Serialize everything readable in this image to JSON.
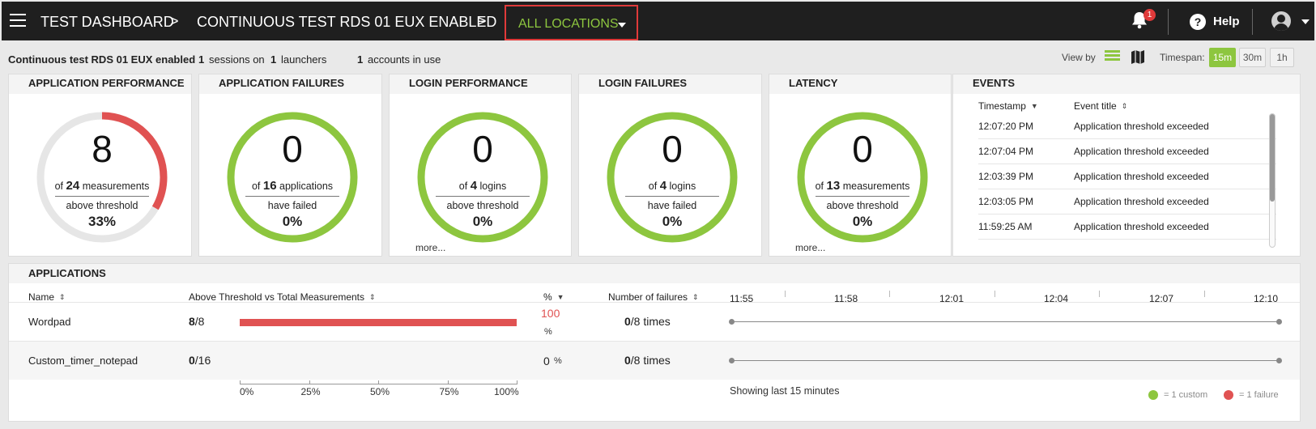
{
  "header": {
    "breadcrumb": [
      "TEST DASHBOARD",
      "CONTINUOUS TEST RDS 01 EUX ENABLED"
    ],
    "separator": ">",
    "location_selector": "ALL LOCATIONS",
    "notification_count": "1",
    "help_icon_glyph": "?",
    "help_label": "Help"
  },
  "info": {
    "test_name": "Continuous test RDS 01 EUX enabled",
    "sessions_count": "1",
    "sessions_label": "sessions on",
    "launchers_count": "1",
    "launchers_label": "launchers",
    "accounts_count": "1",
    "accounts_label": "accounts in use",
    "view_by_label": "View by",
    "timespan_label": "Timespan:",
    "timespans": [
      {
        "label": "15m",
        "active": true
      },
      {
        "label": "30m",
        "active": false
      },
      {
        "label": "1h",
        "active": false
      }
    ]
  },
  "cards": [
    {
      "title": "APPLICATION PERFORMANCE",
      "value": "8",
      "of": "of",
      "count": "24",
      "unit": "measurements",
      "status": "above threshold",
      "percent": "33%",
      "fraction": 0.3333,
      "more": ""
    },
    {
      "title": "APPLICATION FAILURES",
      "value": "0",
      "of": "of",
      "count": "16",
      "unit": "applications",
      "status": "have failed",
      "percent": "0%",
      "fraction": 0,
      "more": ""
    },
    {
      "title": "LOGIN PERFORMANCE",
      "value": "0",
      "of": "of",
      "count": "4",
      "unit": "logins",
      "status": "above threshold",
      "percent": "0%",
      "fraction": 0,
      "more": "more..."
    },
    {
      "title": "LOGIN FAILURES",
      "value": "0",
      "of": "of",
      "count": "4",
      "unit": "logins",
      "status": "have failed",
      "percent": "0%",
      "fraction": 0,
      "more": ""
    },
    {
      "title": "LATENCY",
      "value": "0",
      "of": "of",
      "count": "13",
      "unit": "measurements",
      "status": "above threshold",
      "percent": "0%",
      "fraction": 0,
      "more": "more..."
    }
  ],
  "events": {
    "title": "EVENTS",
    "col_timestamp": "Timestamp",
    "col_title": "Event title",
    "rows": [
      {
        "time": "12:07:20 PM",
        "title": "Application threshold exceeded"
      },
      {
        "time": "12:07:04 PM",
        "title": "Application threshold exceeded"
      },
      {
        "time": "12:03:39 PM",
        "title": "Application threshold exceeded"
      },
      {
        "time": "12:03:05 PM",
        "title": "Application threshold exceeded"
      },
      {
        "time": "11:59:25 AM",
        "title": "Application threshold exceeded"
      }
    ]
  },
  "applications": {
    "title": "APPLICATIONS",
    "columns": {
      "name": "Name",
      "threshold": "Above Threshold vs Total Measurements",
      "percent": "%",
      "failures": "Number of failures"
    },
    "rows": [
      {
        "name": "Wordpad",
        "above": "8",
        "total": "/8",
        "fraction": 1.0,
        "percent": "100",
        "percent_unit": "%",
        "failures": "0",
        "failures_total": "/8 times"
      },
      {
        "name": "Custom_timer_notepad",
        "above": "0",
        "total": "/16",
        "fraction": 0,
        "percent": "0",
        "percent_unit": "%",
        "failures": "0",
        "failures_total": "/8 times"
      }
    ],
    "axis_labels": [
      "0%",
      "25%",
      "50%",
      "75%",
      "100%"
    ],
    "timeline_ticks": [
      "11:55",
      "11:58",
      "12:01",
      "12:04",
      "12:07",
      "12:10"
    ],
    "showing_text": "Showing last 15 minutes",
    "legend": [
      {
        "label": "= 1 custom",
        "color": "#8dc63f"
      },
      {
        "label": "= 1 failure",
        "color": "#e05252"
      }
    ]
  },
  "colors": {
    "accent_green": "#8dc63f",
    "alert_red": "#e05252",
    "gauge_track": "#e6e6e6"
  }
}
